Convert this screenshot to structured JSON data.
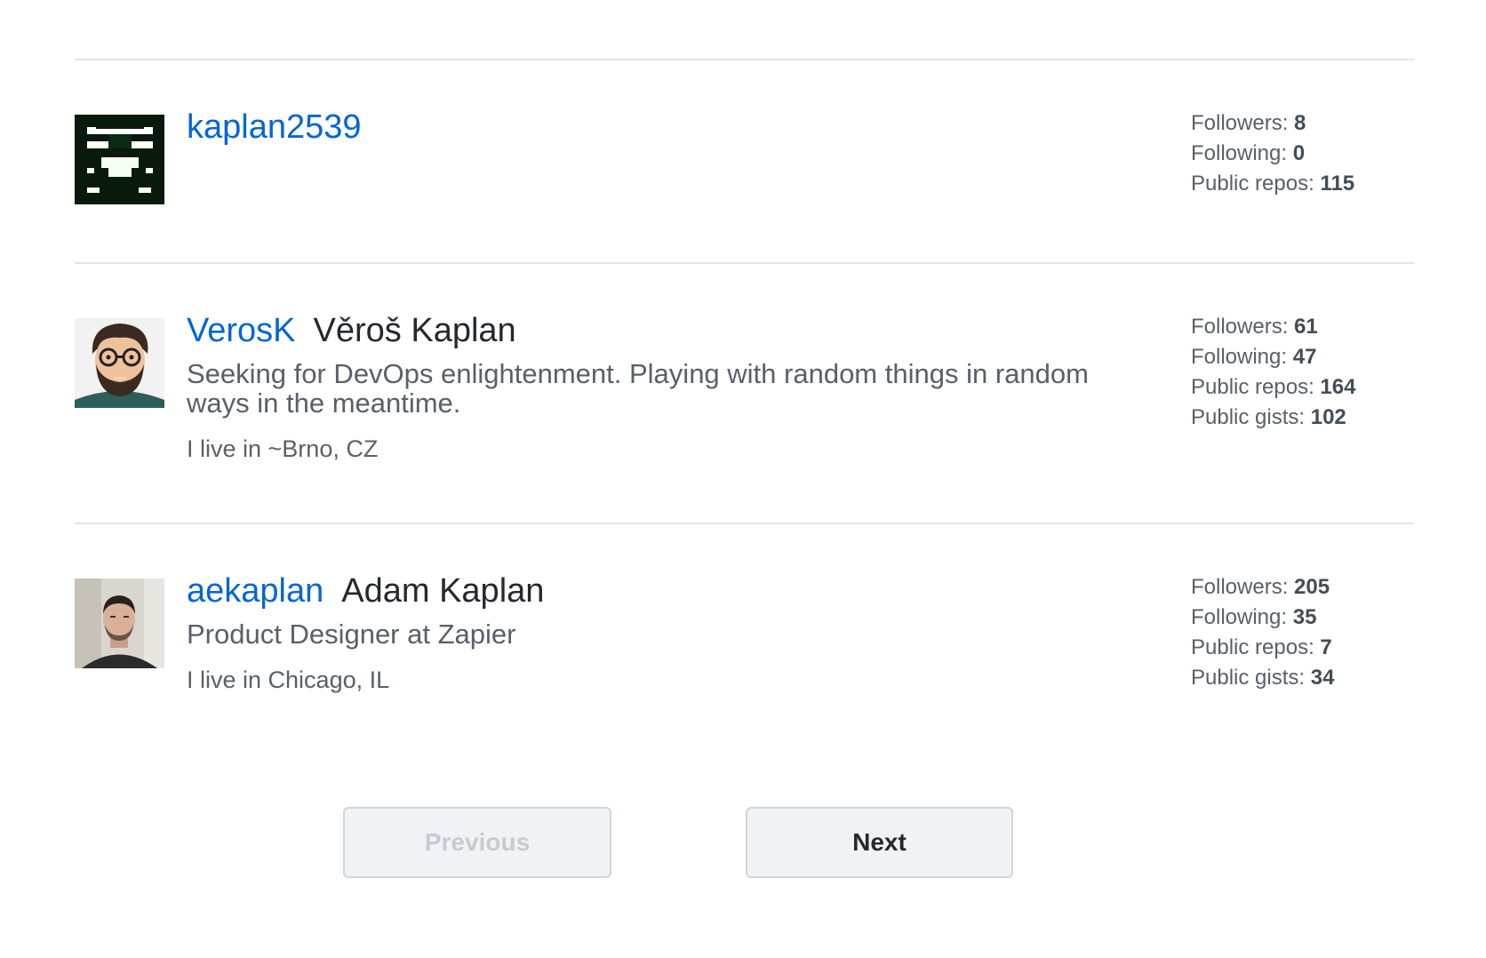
{
  "users": [
    {
      "login": "kaplan2539",
      "name": "",
      "bio": "",
      "location": "",
      "avatar": "pixel-identicon",
      "stats": [
        {
          "label": "Followers:",
          "value": "8"
        },
        {
          "label": "Following:",
          "value": "0"
        },
        {
          "label": "Public repos:",
          "value": "115"
        }
      ]
    },
    {
      "login": "VerosK",
      "name": "Věroš Kaplan",
      "bio": "Seeking for DevOps enlightenment.  Playing with random things in random ways in the meantime.",
      "location": "I live in ~Brno, CZ",
      "avatar": "cartoon-avatar",
      "stats": [
        {
          "label": "Followers:",
          "value": "61"
        },
        {
          "label": "Following:",
          "value": "47"
        },
        {
          "label": "Public repos:",
          "value": "164"
        },
        {
          "label": "Public gists:",
          "value": "102"
        }
      ]
    },
    {
      "login": "aekaplan",
      "name": "Adam Kaplan",
      "bio": "Product Designer at Zapier",
      "location": "I live in Chicago, IL",
      "avatar": "photo-avatar",
      "stats": [
        {
          "label": "Followers:",
          "value": "205"
        },
        {
          "label": "Following:",
          "value": "35"
        },
        {
          "label": "Public repos:",
          "value": "7"
        },
        {
          "label": "Public gists:",
          "value": "34"
        }
      ]
    }
  ],
  "pagination": {
    "previous_label": "Previous",
    "next_label": "Next"
  },
  "colors": {
    "link": "#0366d6",
    "text": "#24292e",
    "muted": "#586069",
    "divider": "#e1e4e8"
  }
}
